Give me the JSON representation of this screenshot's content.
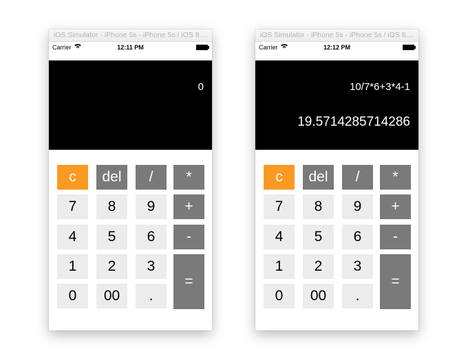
{
  "simulators": [
    {
      "title": "iOS Simulator - iPhone 5s - iPhone 5s / iOS 8....",
      "status": {
        "carrier": "Carrier",
        "time": "12:11 PM"
      },
      "display": {
        "expression": "0",
        "result": ""
      }
    },
    {
      "title": "iOS Simulator - iPhone 5s - iPhone 5s / iOS 8....",
      "status": {
        "carrier": "Carrier",
        "time": "12:12 PM"
      },
      "display": {
        "expression": "10/7*6+3*4-1",
        "result": "19.5714285714286"
      }
    }
  ],
  "keypad": {
    "clear": "c",
    "delete": "del",
    "divide": "/",
    "multiply": "*",
    "seven": "7",
    "eight": "8",
    "nine": "9",
    "plus": "+",
    "four": "4",
    "five": "5",
    "six": "6",
    "minus": "-",
    "one": "1",
    "two": "2",
    "three": "3",
    "equals": "=",
    "zero": "0",
    "double_zero": "00",
    "decimal": "."
  },
  "colors": {
    "clear_key": "#fa9a22",
    "operator_key": "#7a7a7a",
    "digit_key": "#ececec",
    "display_bg": "#000000"
  }
}
